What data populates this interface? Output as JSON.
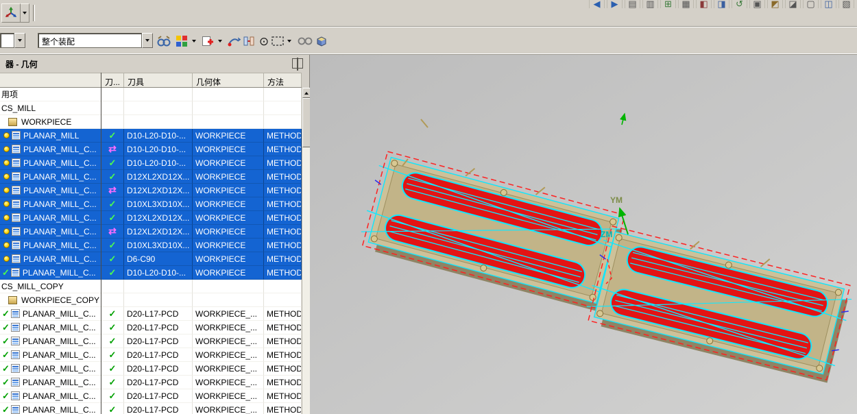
{
  "top_bar": {
    "right_icons": [
      {
        "glyph": "◀",
        "color": "#2a5fb0"
      },
      {
        "glyph": "▶",
        "color": "#2a5fb0"
      },
      {
        "glyph": "▤",
        "color": "#555555"
      },
      {
        "glyph": "▥",
        "color": "#555555"
      },
      {
        "glyph": "⊞",
        "color": "#3a7a3a"
      },
      {
        "glyph": "▦",
        "color": "#555555"
      },
      {
        "glyph": "◧",
        "color": "#8a3a3a"
      },
      {
        "glyph": "◨",
        "color": "#3a5f9f"
      },
      {
        "glyph": "↺",
        "color": "#3a7a3a"
      },
      {
        "glyph": "▣",
        "color": "#555555"
      },
      {
        "glyph": "◩",
        "color": "#8a6a2a"
      },
      {
        "glyph": "◪",
        "color": "#555555"
      },
      {
        "glyph": "▢",
        "color": "#555555"
      },
      {
        "glyph": "◫",
        "color": "#3a5f9f"
      },
      {
        "glyph": "▧",
        "color": "#555555"
      }
    ]
  },
  "assembly_toolbar": {
    "filter_combo": {
      "value": ""
    },
    "scope_combo": {
      "value": "整个装配"
    },
    "wave_glyph": "⊙",
    "icons": [
      "find-component-icon",
      "open-by-proximity-icon",
      "add-component-icon",
      "move-component-icon",
      "assembly-constraints-icon",
      "wave-geometry-linker-icon",
      "selection-rectangle-icon",
      "show-hide-component-icon",
      "exploded-views-icon"
    ]
  },
  "navigator": {
    "title": "器 - 几何",
    "columns": [
      "",
      "刀...",
      "刀具",
      "几何体",
      "方法"
    ],
    "rows": [
      {
        "kind": "plain",
        "name": "用项",
        "tool": "",
        "geometry": "",
        "method": ""
      },
      {
        "kind": "plain",
        "name": "CS_MILL",
        "tool": "",
        "geometry": "",
        "method": ""
      },
      {
        "kind": "geom",
        "name": "WORKPIECE",
        "tool": "",
        "geometry": "",
        "method": ""
      },
      {
        "kind": "op",
        "selected": true,
        "left": "bulb",
        "status": "check",
        "name": "PLANAR_MILL",
        "tool": "D10-L20-D10-...",
        "geometry": "WORKPIECE",
        "method": "METHOD"
      },
      {
        "kind": "op",
        "selected": true,
        "left": "bulb",
        "status": "swap",
        "name": "PLANAR_MILL_C...",
        "tool": "D10-L20-D10-...",
        "geometry": "WORKPIECE",
        "method": "METHOD"
      },
      {
        "kind": "op",
        "selected": true,
        "left": "bulb",
        "status": "check",
        "name": "PLANAR_MILL_C...",
        "tool": "D10-L20-D10-...",
        "geometry": "WORKPIECE",
        "method": "METHOD"
      },
      {
        "kind": "op",
        "selected": true,
        "left": "bulb",
        "status": "check",
        "name": "PLANAR_MILL_C...",
        "tool": "D12XL2XD12X...",
        "geometry": "WORKPIECE",
        "method": "METHOD"
      },
      {
        "kind": "op",
        "selected": true,
        "left": "bulb",
        "status": "swap",
        "name": "PLANAR_MILL_C...",
        "tool": "D12XL2XD12X...",
        "geometry": "WORKPIECE",
        "method": "METHOD"
      },
      {
        "kind": "op",
        "selected": true,
        "left": "bulb",
        "status": "check",
        "name": "PLANAR_MILL_C...",
        "tool": "D10XL3XD10X...",
        "geometry": "WORKPIECE",
        "method": "METHOD"
      },
      {
        "kind": "op",
        "selected": true,
        "left": "bulb",
        "status": "check",
        "name": "PLANAR_MILL_C...",
        "tool": "D12XL2XD12X...",
        "geometry": "WORKPIECE",
        "method": "METHOD"
      },
      {
        "kind": "op",
        "selected": true,
        "left": "bulb",
        "status": "swap",
        "name": "PLANAR_MILL_C...",
        "tool": "D12XL2XD12X...",
        "geometry": "WORKPIECE",
        "method": "METHOD"
      },
      {
        "kind": "op",
        "selected": true,
        "left": "bulb",
        "status": "check",
        "name": "PLANAR_MILL_C...",
        "tool": "D10XL3XD10X...",
        "geometry": "WORKPIECE",
        "method": "METHOD"
      },
      {
        "kind": "op",
        "selected": true,
        "left": "bulb",
        "status": "check",
        "name": "PLANAR_MILL_C...",
        "tool": "D6-C90",
        "geometry": "WORKPIECE",
        "method": "METHOD"
      },
      {
        "kind": "op",
        "selected": true,
        "left": "check",
        "status": "check",
        "name": "PLANAR_MILL_C...",
        "tool": "D10-L20-D10-...",
        "geometry": "WORKPIECE",
        "method": "METHOD"
      },
      {
        "kind": "plain",
        "name": "CS_MILL_COPY",
        "tool": "",
        "geometry": "",
        "method": ""
      },
      {
        "kind": "geom",
        "name": "WORKPIECE_COPY",
        "tool": "",
        "geometry": "",
        "method": ""
      },
      {
        "kind": "op",
        "selected": false,
        "left": "check",
        "status": "check",
        "name": "PLANAR_MILL_C...",
        "tool": "D20-L17-PCD",
        "geometry": "WORKPIECE_...",
        "method": "METHOD"
      },
      {
        "kind": "op",
        "selected": false,
        "left": "check",
        "status": "check",
        "name": "PLANAR_MILL_C...",
        "tool": "D20-L17-PCD",
        "geometry": "WORKPIECE_...",
        "method": "METHOD"
      },
      {
        "kind": "op",
        "selected": false,
        "left": "check",
        "status": "check",
        "name": "PLANAR_MILL_C...",
        "tool": "D20-L17-PCD",
        "geometry": "WORKPIECE_...",
        "method": "METHOD"
      },
      {
        "kind": "op",
        "selected": false,
        "left": "check",
        "status": "check",
        "name": "PLANAR_MILL_C...",
        "tool": "D20-L17-PCD",
        "geometry": "WORKPIECE_...",
        "method": "METHOD"
      },
      {
        "kind": "op",
        "selected": false,
        "left": "check",
        "status": "check",
        "name": "PLANAR_MILL_C...",
        "tool": "D20-L17-PCD",
        "geometry": "WORKPIECE_...",
        "method": "METHOD"
      },
      {
        "kind": "op",
        "selected": false,
        "left": "check",
        "status": "check",
        "name": "PLANAR_MILL_C...",
        "tool": "D20-L17-PCD",
        "geometry": "WORKPIECE_...",
        "method": "METHOD"
      },
      {
        "kind": "op",
        "selected": false,
        "left": "check",
        "status": "check",
        "name": "PLANAR_MILL_C...",
        "tool": "D20-L17-PCD",
        "geometry": "WORKPIECE_...",
        "method": "METHOD"
      },
      {
        "kind": "op",
        "selected": false,
        "left": "check",
        "status": "check",
        "name": "PLANAR_MILL_C...",
        "tool": "D20-L17-PCD",
        "geometry": "WORKPIECE_...",
        "method": "METHOD"
      }
    ]
  },
  "glyphs": {
    "check": "✓",
    "swap": "⇄"
  },
  "viewport": {
    "labels": {
      "ym": "YM",
      "zm": "ZM"
    }
  },
  "colors": {
    "selection": "#1464d2",
    "check_green": "#00a000",
    "swap_magenta": "#c400c4",
    "slot_red": "#e31414",
    "path_cyan": "#10e8ff",
    "boundary_red": "#ff2020",
    "panel_bg": "#d4d0c8"
  }
}
